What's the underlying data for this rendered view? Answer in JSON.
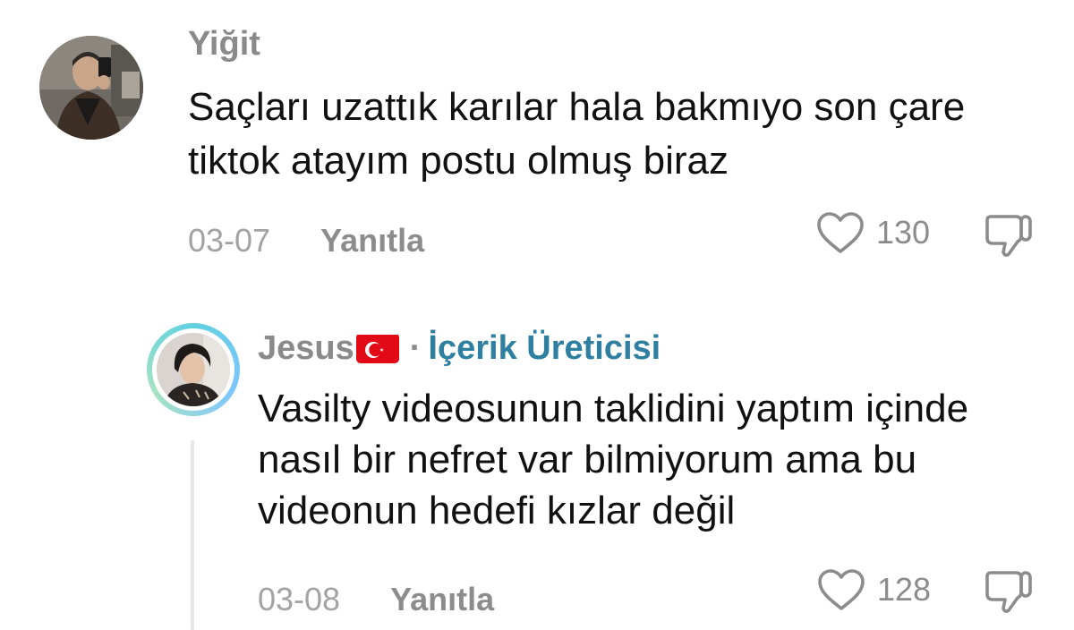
{
  "comments": [
    {
      "author": "Yiğit",
      "text": "Saçları uzattık karılar hala bakmıyo son çare tiktok atayım postu olmuş biraz",
      "date": "03-07",
      "reply_label": "Yanıtla",
      "likes": "130"
    }
  ],
  "reply": {
    "author": "Jesus",
    "separator": "·",
    "badge": "İçerik Üreticisi",
    "text": "Vasilty videosunun taklidini yaptım içinde nasıl bir nefret var bilmiyorum ama bu videonun hedefi kızlar değil",
    "date": "03-08",
    "reply_label": "Yanıtla",
    "likes": "128"
  },
  "icons": {
    "like": "heart-outline-icon",
    "dislike": "thumbs-down-icon",
    "flag": "turkey-flag-icon"
  },
  "colors": {
    "text": "#111111",
    "muted": "#8a8a8a",
    "creator_badge": "#2f7fa1",
    "flag_red": "#e30a17"
  }
}
